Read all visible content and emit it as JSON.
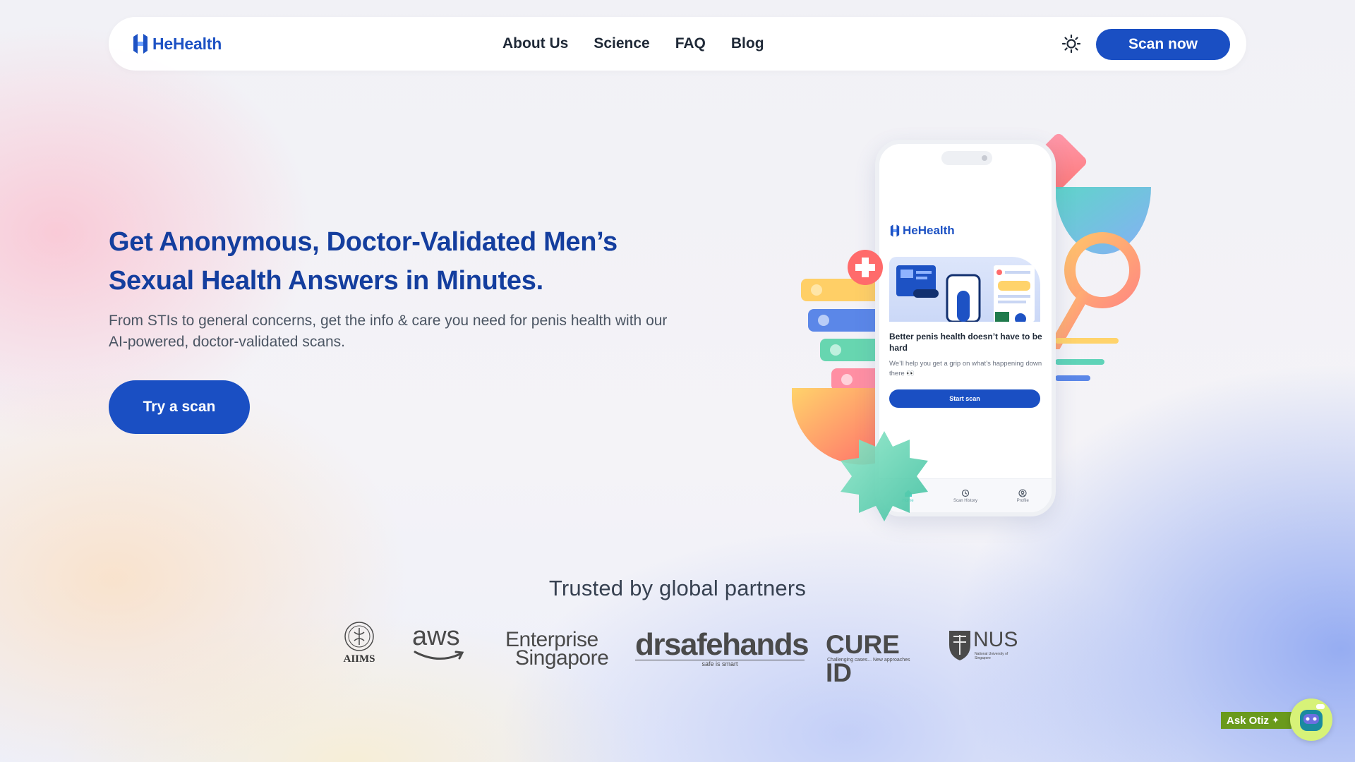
{
  "brand": {
    "name": "HeHealth",
    "color": "#1d52c4"
  },
  "nav": {
    "links": [
      "About Us",
      "Science",
      "FAQ",
      "Blog"
    ],
    "theme_icon": "sun-icon",
    "cta": "Scan now"
  },
  "hero": {
    "title": "Get Anonymous, Doctor-Validated Men’s Sexual Health Answers in Minutes.",
    "subtitle": "From STIs to general concerns, get the info & care you need for penis health with our AI-powered, doctor-validated scans.",
    "cta": "Try a scan"
  },
  "phone": {
    "brand": "HeHealth",
    "heading": "Better penis health doesn’t have to be hard",
    "description": "We’ll help you get a grip on what’s happening down there 👀",
    "button": "Start scan",
    "tabs": [
      {
        "label": "Home",
        "icon": "home-icon"
      },
      {
        "label": "Scan History",
        "icon": "history-icon"
      },
      {
        "label": "Profile",
        "icon": "profile-icon"
      }
    ]
  },
  "trusted": {
    "title": "Trusted by global partners",
    "partners": [
      {
        "name": "AIIMS"
      },
      {
        "name": "aws"
      },
      {
        "name": "Enterprise Singapore",
        "line1": "Enterprise",
        "line2": "Singapore"
      },
      {
        "name": "drsafehands",
        "tagline": "safe is smart"
      },
      {
        "name": "CURE ID",
        "tagline": "Challenging cases... New approaches"
      },
      {
        "name": "NUS",
        "tagline": "National University of Singapore"
      }
    ]
  },
  "chat": {
    "label": "Ask Otiz",
    "icon": "sparkle-icon",
    "avatar": "robot-avatar-icon"
  },
  "colors": {
    "primary": "#1a4fc3",
    "heading": "#143e9e",
    "chat_green": "#6a9a1c"
  }
}
